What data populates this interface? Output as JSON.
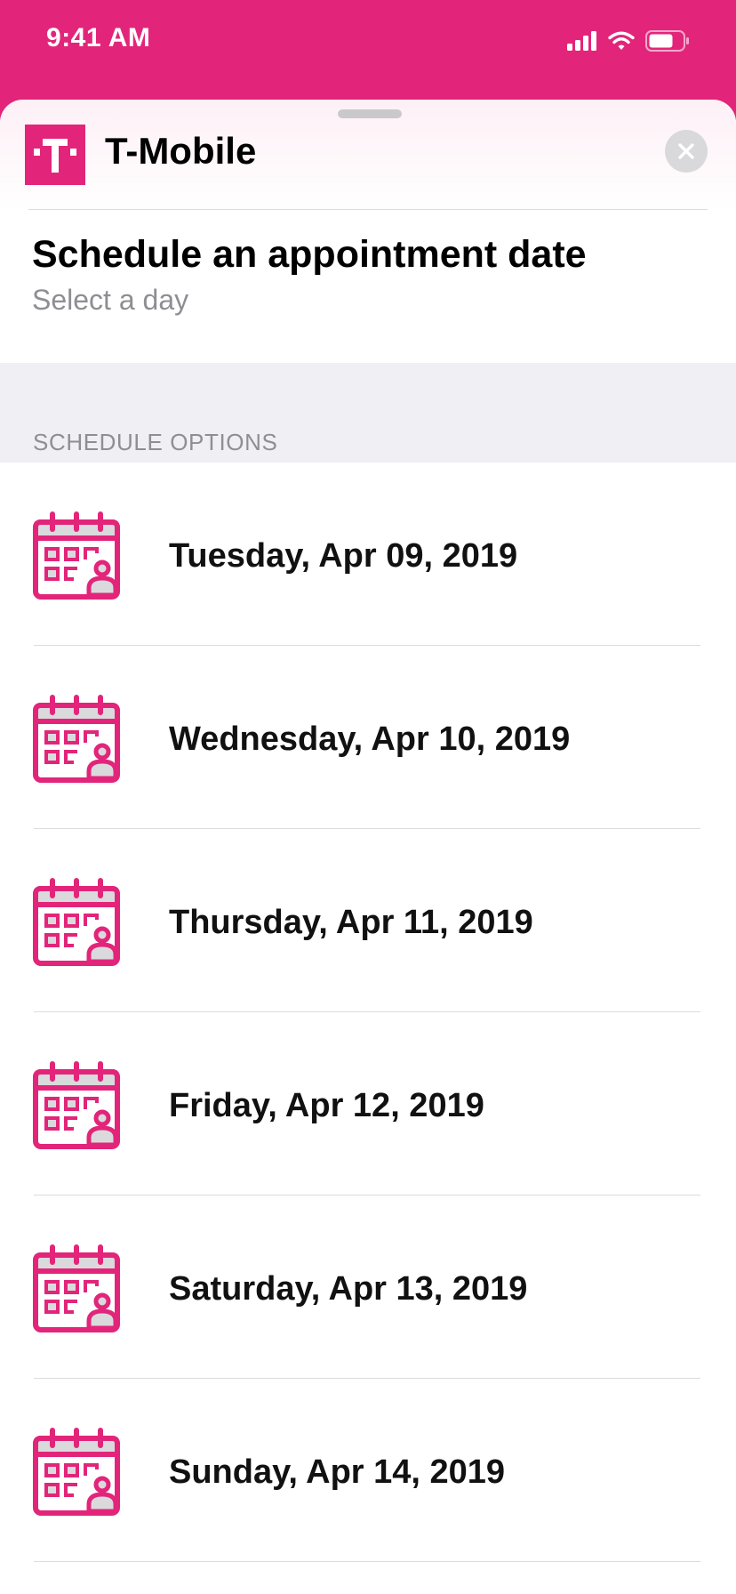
{
  "status_bar": {
    "time": "9:41 AM"
  },
  "header": {
    "brand_name": "T-Mobile",
    "close_icon": "close-icon"
  },
  "page": {
    "title": "Schedule an appointment date",
    "subtitle": "Select a day"
  },
  "section": {
    "header": "SCHEDULE OPTIONS"
  },
  "days": [
    {
      "label": "Tuesday, Apr 09, 2019"
    },
    {
      "label": "Wednesday, Apr 10, 2019"
    },
    {
      "label": "Thursday, Apr 11, 2019"
    },
    {
      "label": "Friday, Apr 12, 2019"
    },
    {
      "label": "Saturday, Apr 13, 2019"
    },
    {
      "label": "Sunday, Apr 14, 2019"
    }
  ],
  "colors": {
    "brand": "#e2257a",
    "icon_fill": "#dadadd",
    "secondary_text": "#8e8e93"
  }
}
